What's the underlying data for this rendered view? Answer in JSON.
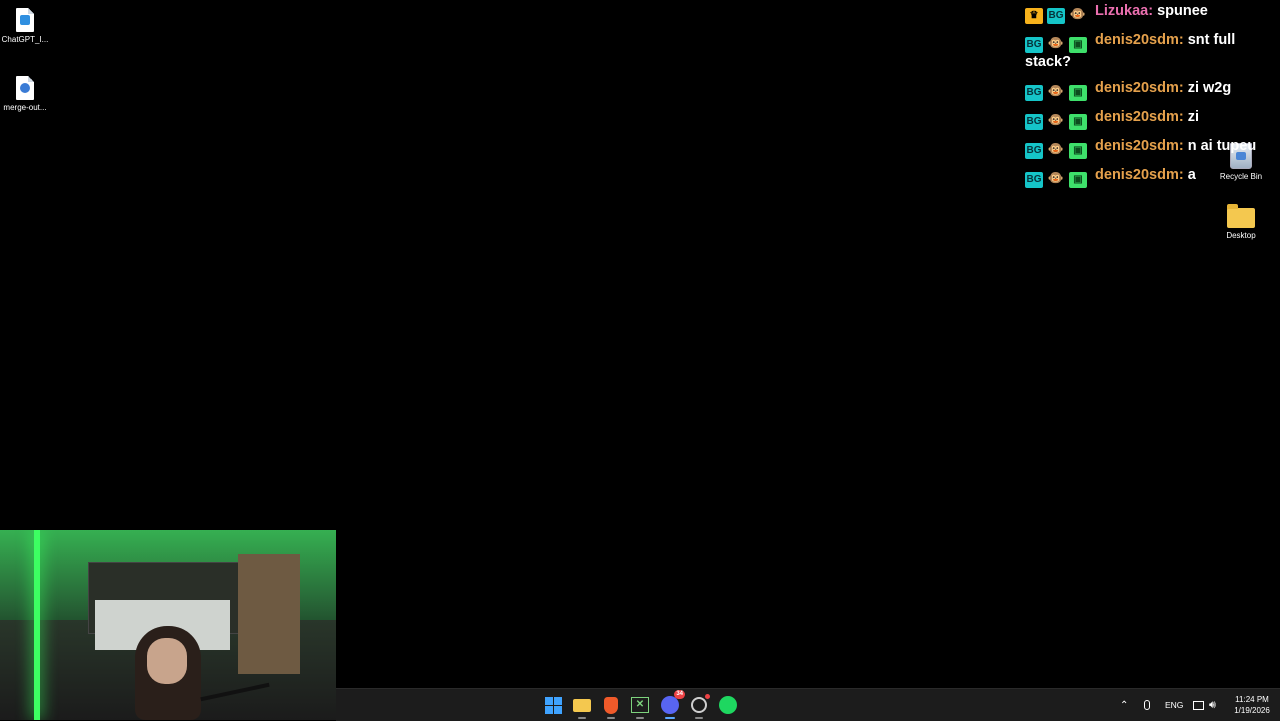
{
  "desktop": {
    "icons_left": [
      {
        "label": "ChatGPT_I...",
        "icon": "image-file-icon"
      },
      {
        "label": "merge-out...",
        "icon": "audio-file-icon"
      }
    ],
    "icons_right": [
      {
        "label": "Recycle Bin",
        "icon": "recycle-bin-icon"
      },
      {
        "label": "Desktop",
        "icon": "folder-icon"
      }
    ]
  },
  "chat": {
    "messages": [
      {
        "user": "Lizukaa:",
        "text": "spunee",
        "user_color": "#ea6faf",
        "badges": [
          "crown-badge",
          "bg-badge",
          "monkey-badge"
        ]
      },
      {
        "user": "denis20sdm:",
        "text": "snt full stack?",
        "user_color": "#e5a14c",
        "badges": [
          "bg-badge",
          "monkey-badge",
          "gift-badge"
        ]
      },
      {
        "user": "denis20sdm:",
        "text": "zi w2g",
        "user_color": "#e5a14c",
        "badges": [
          "bg-badge",
          "monkey-badge",
          "gift-badge"
        ]
      },
      {
        "user": "denis20sdm:",
        "text": "zi",
        "user_color": "#e5a14c",
        "badges": [
          "bg-badge",
          "monkey-badge",
          "gift-badge"
        ]
      },
      {
        "user": "denis20sdm:",
        "text": "n ai tupeu",
        "user_color": "#e5a14c",
        "badges": [
          "bg-badge",
          "monkey-badge",
          "gift-badge"
        ]
      },
      {
        "user": "denis20sdm:",
        "text": "a",
        "user_color": "#e5a14c",
        "badges": [
          "bg-badge",
          "monkey-badge",
          "gift-badge"
        ]
      }
    ]
  },
  "taskbar": {
    "apps": [
      {
        "name": "start-button",
        "icon": "windows-logo-icon"
      },
      {
        "name": "file-explorer-button",
        "icon": "folder-icon"
      },
      {
        "name": "brave-button",
        "icon": "brave-lion-icon"
      },
      {
        "name": "xbox-button",
        "icon": "xbox-icon"
      },
      {
        "name": "discord-button",
        "icon": "discord-icon",
        "badge": "34"
      },
      {
        "name": "obs-button",
        "icon": "obs-icon"
      },
      {
        "name": "spotify-button",
        "icon": "spotify-icon"
      }
    ],
    "tray": {
      "lang": "ENG",
      "time": "11:24 PM",
      "date": "1/19/2026"
    }
  },
  "colors": {
    "background": "#000000",
    "taskbar": "#1c1c1c",
    "accent": "#5ca8ff"
  }
}
